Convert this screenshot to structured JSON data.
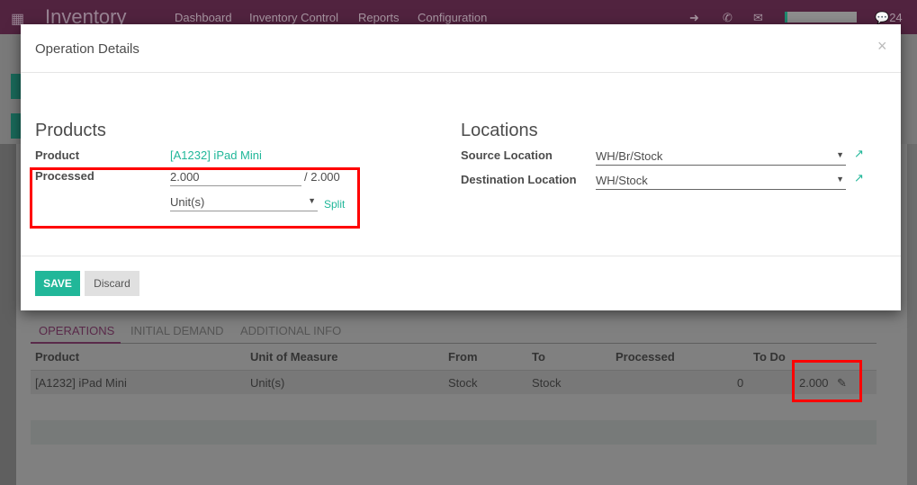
{
  "navbar": {
    "app_title": "Inventory",
    "menu": [
      "Dashboard",
      "Inventory Control",
      "Reports",
      "Configuration"
    ],
    "message_count": "24"
  },
  "background": {
    "tabs": [
      "OPERATIONS",
      "INITIAL DEMAND",
      "ADDITIONAL INFO"
    ],
    "columns": [
      "Product",
      "Unit of Measure",
      "From",
      "To",
      "Processed",
      "To Do"
    ],
    "rows": [
      {
        "product": "[A1232] iPad Mini",
        "uom": "Unit(s)",
        "from": "Stock",
        "to": "Stock",
        "processed": "0",
        "todo": "2.000"
      }
    ]
  },
  "modal": {
    "title": "Operation Details",
    "close": "×",
    "products": {
      "heading": "Products",
      "product_label": "Product",
      "product_value": "[A1232] iPad Mini",
      "processed_label": "Processed",
      "processed_value": "2.000",
      "processed_total": "/ 2.000",
      "uom_value": "Unit(s)",
      "split": "Split"
    },
    "locations": {
      "heading": "Locations",
      "source_label": "Source Location",
      "source_value": "WH/Br/Stock",
      "dest_label": "Destination Location",
      "dest_value": "WH/Stock"
    },
    "save": "SAVE",
    "discard": "Discard"
  },
  "colors": {
    "brand": "#875A7B",
    "accent": "#21b799",
    "highlight": "#ff0000"
  }
}
